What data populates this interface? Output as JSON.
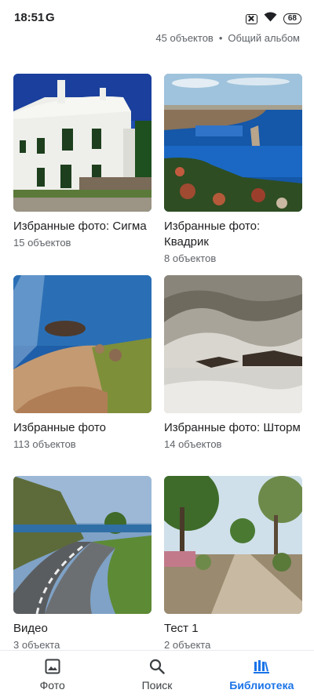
{
  "status_bar": {
    "time": "18:51",
    "carrier_icon": "G",
    "battery": "68"
  },
  "header": {
    "count": "45 объектов",
    "separator": "•",
    "type": "Общий альбом"
  },
  "albums": [
    {
      "title": "Избранные фото: Сигма",
      "count": "15 объектов"
    },
    {
      "title": "Избранные фото: Квадрик",
      "count": "8 объектов"
    },
    {
      "title": "Избранные фото",
      "count": "113 объектов"
    },
    {
      "title": "Избранные фото: Шторм",
      "count": "14 объектов"
    },
    {
      "title": "Видео",
      "count": "3 объекта"
    },
    {
      "title": "Тест 1",
      "count": "2 объекта"
    }
  ],
  "nav": {
    "photos": "Фото",
    "search": "Поиск",
    "library": "Библиотека"
  },
  "colors": {
    "accent": "#1a73e8",
    "text": "#202124",
    "secondary": "#5f6368"
  }
}
